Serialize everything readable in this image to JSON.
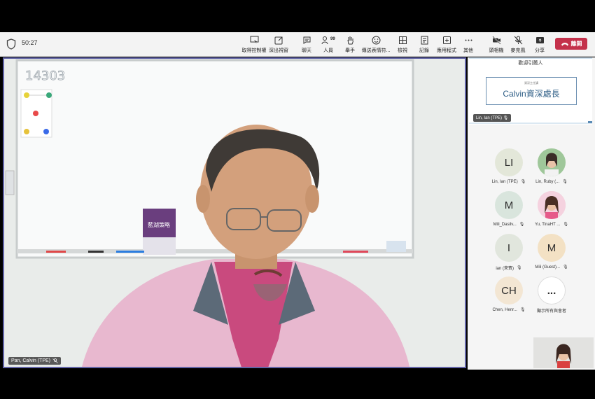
{
  "meeting": {
    "timer": "50:27"
  },
  "toolbar": {
    "items": [
      {
        "label": "取得控制權",
        "icon": "take-control-icon"
      },
      {
        "label": "深出視窗",
        "icon": "pop-out-icon"
      },
      {
        "label": "聊天",
        "icon": "chat-icon"
      },
      {
        "label": "人員",
        "icon": "people-icon",
        "badge": "99"
      },
      {
        "label": "舉手",
        "icon": "raise-hand-icon"
      },
      {
        "label": "傳送表情符...",
        "icon": "reactions-icon"
      },
      {
        "label": "檢視",
        "icon": "view-icon"
      },
      {
        "label": "記錄",
        "icon": "notes-icon"
      },
      {
        "label": "應用程式",
        "icon": "apps-icon"
      },
      {
        "label": "其他",
        "icon": "more-icon"
      },
      {
        "label": "頭相機",
        "icon": "camera-off-icon"
      },
      {
        "label": "麥克風",
        "icon": "mic-off-icon"
      },
      {
        "label": "分享",
        "icon": "share-icon"
      }
    ],
    "leave_label": "離開",
    "accent_color": "#c4314b"
  },
  "main_video": {
    "speaker_name": "Pan, Calvin (TPE)",
    "whiteboard_text": "14303",
    "book_title": "藍湖策略",
    "border_color": "#6264a7"
  },
  "shared_content": {
    "title": "歡迎引薦人",
    "small_text": "資深主任講",
    "big_text": "Calvin資深處長",
    "presenter_tag": "Lin, Ian (TPE)"
  },
  "participants": [
    {
      "initials": "LI",
      "name": "Lin, Ian (TPE)",
      "bg": "#e3e7d9",
      "photo": false
    },
    {
      "initials": "",
      "name": "Lin, Ruby (...",
      "bg": "#cfe0c8",
      "photo": true
    },
    {
      "initials": "M",
      "name": "Mili_Dasilv...",
      "bg": "#d9e5dd",
      "photo": false
    },
    {
      "initials": "",
      "name": "Yu, TinaHT ...",
      "bg": "#f2c6d4",
      "photo": true
    },
    {
      "initials": "I",
      "name": "ian (來賓)",
      "bg": "#e1e6dd",
      "photo": false
    },
    {
      "initials": "M",
      "name": "Mili (Guest)...",
      "bg": "#f3e1c4",
      "photo": false
    },
    {
      "initials": "CH",
      "name": "Chen, Henr...",
      "bg": "#f3e6d3",
      "photo": false
    },
    {
      "initials": "...",
      "name": "顯示所有與會者",
      "bg": "#ffffff",
      "photo": false
    }
  ]
}
